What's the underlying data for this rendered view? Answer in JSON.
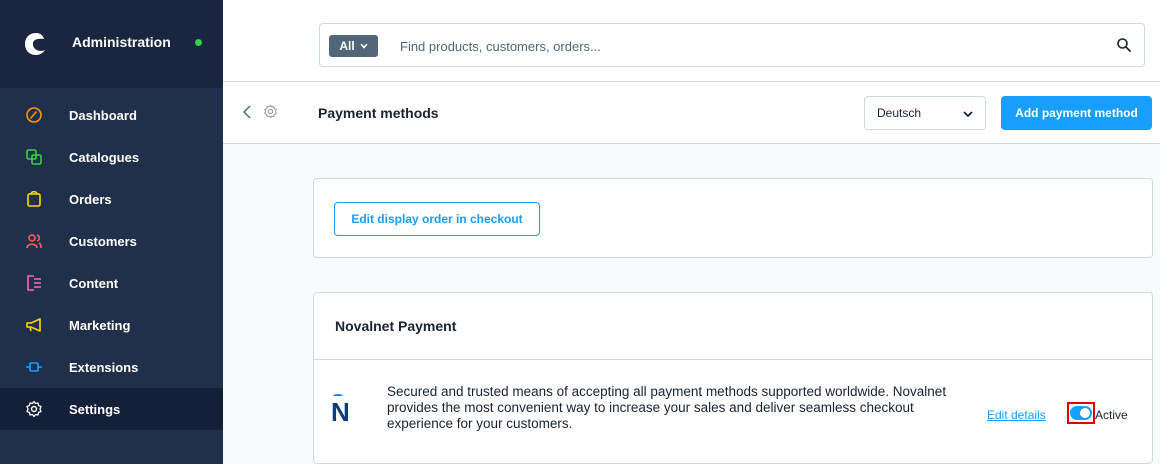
{
  "sidebar": {
    "brand": {
      "title": "Administration",
      "status_color": "#37d046"
    },
    "items": [
      {
        "label": "Dashboard",
        "icon": "gauge-icon",
        "color": "#ff9800"
      },
      {
        "label": "Catalogues",
        "icon": "catalogue-icon",
        "color": "#37d046"
      },
      {
        "label": "Orders",
        "icon": "shopping-bag-icon",
        "color": "#ffd700"
      },
      {
        "label": "Customers",
        "icon": "users-icon",
        "color": "#ff5c5c"
      },
      {
        "label": "Content",
        "icon": "content-icon",
        "color": "#ff68b4"
      },
      {
        "label": "Marketing",
        "icon": "megaphone-icon",
        "color": "#ffd700"
      },
      {
        "label": "Extensions",
        "icon": "plug-icon",
        "color": "#189eff"
      },
      {
        "label": "Settings",
        "icon": "gear-icon",
        "color": "#ffffff",
        "active": true
      }
    ]
  },
  "search": {
    "type_label": "All",
    "placeholder": "Find products, customers, orders..."
  },
  "smartbar": {
    "title": "Payment methods",
    "language": "Deutsch",
    "add_button": "Add payment method"
  },
  "display_order": {
    "button": "Edit display order in checkout"
  },
  "payment_card": {
    "title": "Novalnet Payment",
    "logo_letter": "N",
    "description": "Secured and trusted means of accepting all payment methods supported worldwide. Novalnet provides the most convenient way to increase your sales and deliver seamless checkout experience for your customers.",
    "edit_link": "Edit details",
    "status_label": "Active",
    "active": true
  },
  "colors": {
    "accent": "#189eff",
    "sidebar_bg": "#21304a",
    "highlight_border": "#e00000"
  }
}
